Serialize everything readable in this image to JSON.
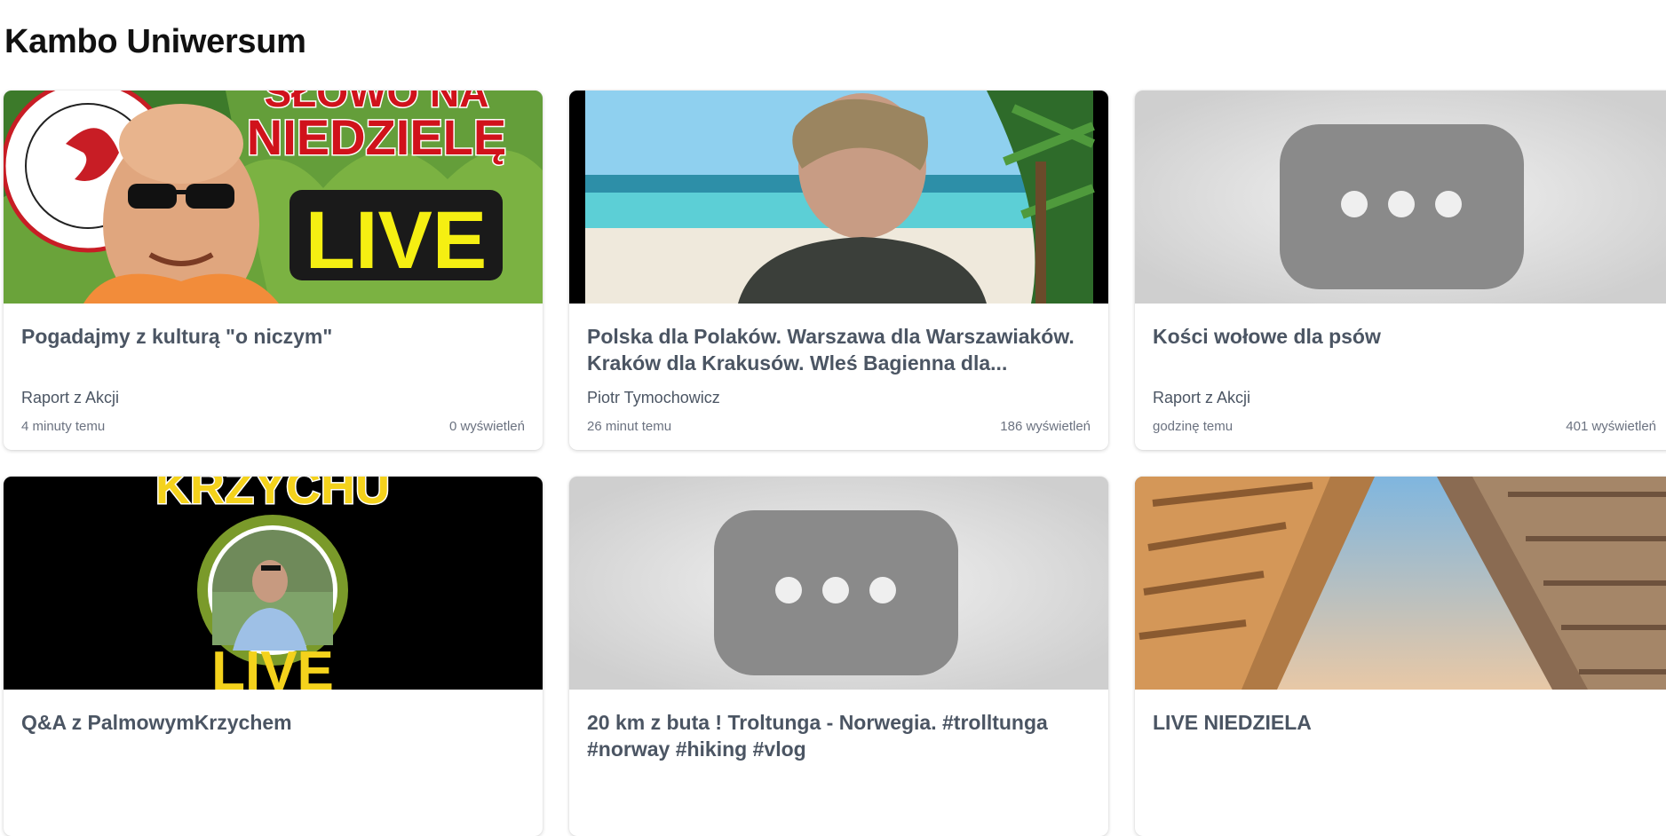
{
  "section": {
    "title": "Kambo Uniwersum"
  },
  "videos": [
    {
      "title": "Pogadajmy z kulturą \"o niczym\"",
      "channel": "Raport z Akcji",
      "age": "4 minuty temu",
      "views": "0 wyświetleń",
      "thumbnail": {
        "kind": "photo-live",
        "overlay_text": [
          "SŁOWO NA",
          "NIEDZIELĘ",
          "LIVE"
        ]
      }
    },
    {
      "title": "Polska dla Polaków. Warszawa dla Warszawiaków. Kraków dla Krakusów. Wleś Bagienna dla...",
      "channel": "Piotr Tymochowicz",
      "age": "26 minut temu",
      "views": "186 wyświetleń",
      "thumbnail": {
        "kind": "photo-beach"
      }
    },
    {
      "title": "Kości wołowe dla psów",
      "channel": "Raport z Akcji",
      "age": "godzinę temu",
      "views": "401 wyświetleń",
      "thumbnail": {
        "kind": "placeholder",
        "icon": "more-dots-icon"
      }
    },
    {
      "title": "Q&A z PalmowymKrzychem",
      "channel": "",
      "age": "",
      "views": "",
      "thumbnail": {
        "kind": "photo-portrait",
        "overlay_text": [
          "KRZYCHU",
          "LIVE"
        ]
      }
    },
    {
      "title": "20 km z buta ! Troltunga - Norwegia. #trolltunga #norway #hiking #vlog",
      "channel": "",
      "age": "",
      "views": "",
      "thumbnail": {
        "kind": "placeholder",
        "icon": "more-dots-icon"
      }
    },
    {
      "title": "LIVE NIEDZIELA",
      "channel": "",
      "age": "",
      "views": "",
      "thumbnail": {
        "kind": "photo-buildings"
      }
    }
  ],
  "colors": {
    "title_text": "#4b5563",
    "meta_text": "#6b7280",
    "placeholder_bg": "#d4d4d4",
    "placeholder_icon": "#8a8a8a",
    "live_yellow": "#f5ef12",
    "live_red": "#d0121b"
  }
}
